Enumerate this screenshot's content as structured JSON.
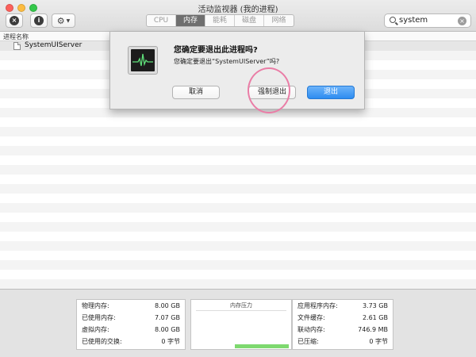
{
  "window": {
    "title": "活动监视器 (我的进程)"
  },
  "toolbar": {
    "stop_icon": "close-icon",
    "info_icon": "info-icon",
    "info_glyph": "i",
    "stop_glyph": "×",
    "gear_icon": "gear-icon"
  },
  "tabs": [
    {
      "label": "CPU",
      "active": false
    },
    {
      "label": "内存",
      "active": true
    },
    {
      "label": "能耗",
      "active": false
    },
    {
      "label": "磁盘",
      "active": false
    },
    {
      "label": "网络",
      "active": false
    }
  ],
  "search": {
    "value": "system"
  },
  "list": {
    "column_header": "进程名称",
    "rows": [
      {
        "name": "SystemUIServer"
      }
    ]
  },
  "dialog": {
    "title": "您确定要退出此进程吗?",
    "message": "您确定要退出“SystemUIServer”吗?",
    "cancel_label": "取消",
    "force_quit_label": "强制退出",
    "quit_label": "退出"
  },
  "memory": {
    "left": [
      {
        "label": "物理内存:",
        "value": "8.00 GB"
      },
      {
        "label": "已使用内存:",
        "value": "7.07 GB"
      },
      {
        "label": "虚拟内存:",
        "value": "8.00 GB"
      },
      {
        "label": "已使用的交换:",
        "value": "0 字节"
      }
    ],
    "pressure_title": "内存压力",
    "right": [
      {
        "label": "应用程序内存:",
        "value": "3.73 GB"
      },
      {
        "label": "文件缓存:",
        "value": "2.61 GB"
      },
      {
        "label": "联动内存:",
        "value": "746.9 MB"
      },
      {
        "label": "已压缩:",
        "value": "0 字节"
      }
    ]
  },
  "colors": {
    "accent": "#2d8cf0",
    "highlight_ring": "#ea7da6",
    "pressure_green": "#7ed96f"
  }
}
